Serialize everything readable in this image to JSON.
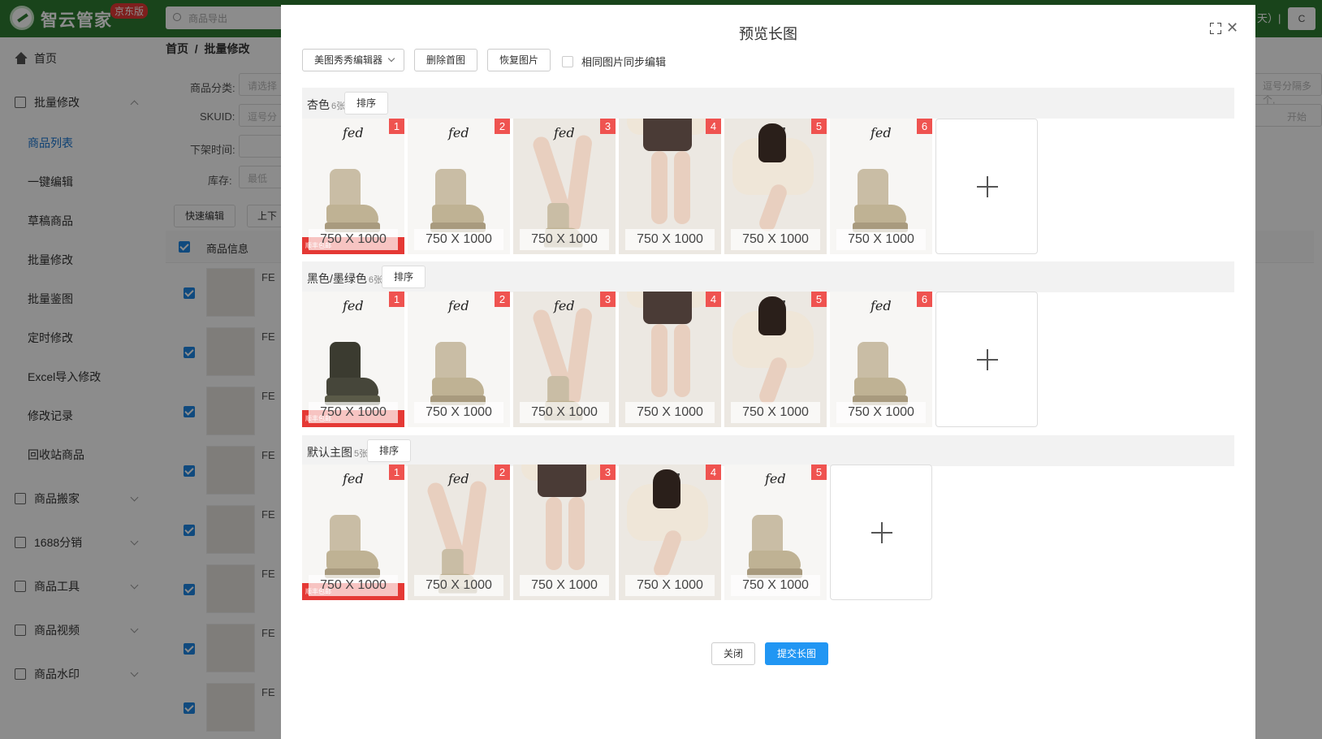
{
  "app": {
    "brand": "智云管家",
    "edition": "京东版",
    "search_placeholder": "商品导出",
    "top_right_text": "天）|",
    "top_right_btn": "C"
  },
  "sidebar": {
    "items": [
      {
        "label": "首页"
      },
      {
        "label": "批量修改"
      },
      {
        "label": "商品搬家"
      },
      {
        "label": "1688分销"
      },
      {
        "label": "商品工具"
      },
      {
        "label": "商品视频"
      },
      {
        "label": "商品水印"
      }
    ],
    "sub_items": [
      "商品列表",
      "一键编辑",
      "草稿商品",
      "批量修改",
      "批量鉴图",
      "定时修改",
      "Excel导入修改",
      "修改记录",
      "回收站商品"
    ]
  },
  "main": {
    "breadcrumb": [
      "首页",
      "批量修改"
    ],
    "filters": [
      {
        "label": "商品分类:",
        "placeholder": "请选择"
      },
      {
        "label": "SKUID:",
        "placeholder": "逗号分"
      },
      {
        "label": "下架时间:",
        "placeholder": ""
      },
      {
        "label": "库存:",
        "placeholder": "最低"
      }
    ],
    "right_placeholder": "逗号分隔多个,",
    "right_time": "开始",
    "toolbar": [
      "快速编辑",
      "上下"
    ],
    "table_header": "商品信息",
    "row_prefix": [
      "FE",
      "FE",
      "FE",
      "FE",
      "FE",
      "FE",
      "FE",
      "FE"
    ]
  },
  "modal": {
    "title": "预览长图",
    "tools": {
      "editor": "美图秀秀编辑器",
      "delete_first": "删除首图",
      "restore": "恢复图片",
      "sync_label": "相同图片同步编辑"
    },
    "sort_label": "排序",
    "dim_label": "750 X 1000",
    "promo_text": "顺丰包邮",
    "logo": "fed",
    "groups": [
      {
        "name": "杏色",
        "count": "6张",
        "images": [
          "1",
          "2",
          "3",
          "4",
          "5",
          "6"
        ]
      },
      {
        "name": "黑色/墨绿色",
        "count": "6张",
        "images": [
          "1",
          "2",
          "3",
          "4",
          "5",
          "6"
        ]
      },
      {
        "name": "默认主图",
        "count": "5张",
        "images": [
          "1",
          "2",
          "3",
          "4",
          "5"
        ]
      }
    ],
    "footer": {
      "close": "关闭",
      "submit": "提交长图"
    }
  }
}
